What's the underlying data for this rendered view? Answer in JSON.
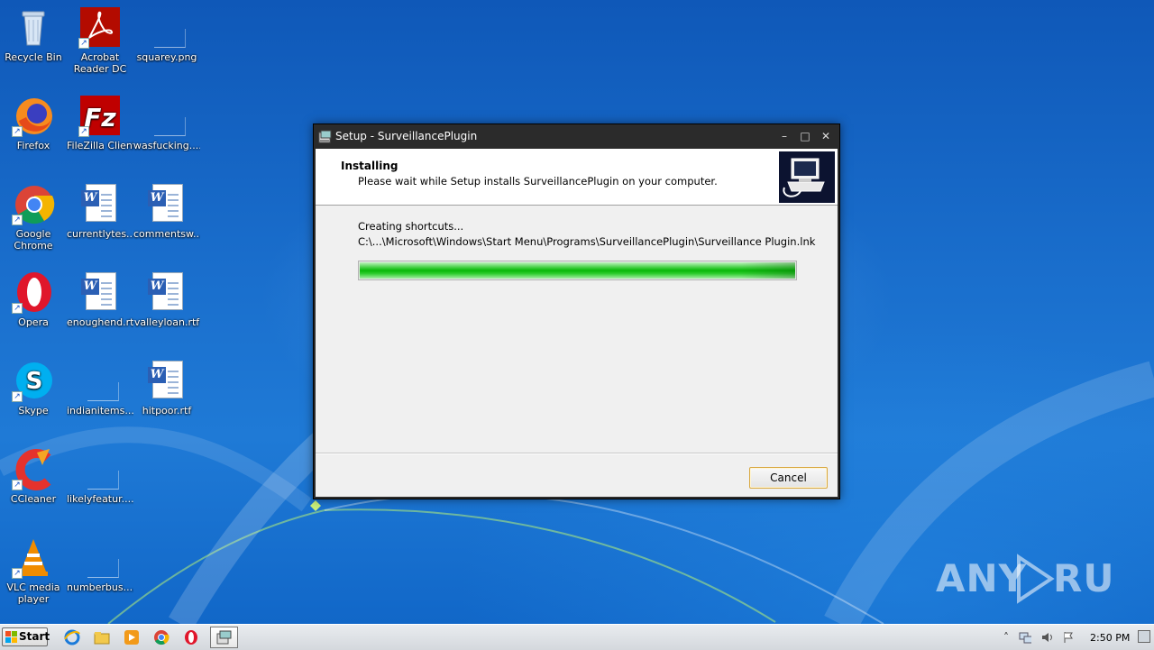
{
  "desktop": {
    "icons": [
      {
        "label": "Recycle Bin",
        "icon": "recycle-bin-icon"
      },
      {
        "label": "Acrobat Reader DC",
        "label_line1": "Acrobat",
        "label_line2": "Reader DC",
        "icon": "acrobat-icon"
      },
      {
        "label": "squarey.png",
        "icon": "image-file-icon"
      },
      {
        "label": "Firefox",
        "icon": "firefox-icon"
      },
      {
        "label": "FileZilla Client",
        "icon": "filezilla-icon"
      },
      {
        "label": "wasfucking....",
        "icon": "file-icon"
      },
      {
        "label": "Google Chrome",
        "label_line1": "Google",
        "label_line2": "Chrome",
        "icon": "chrome-icon"
      },
      {
        "label": "currentlytes....",
        "icon": "word-doc-icon"
      },
      {
        "label": "commentsw....",
        "icon": "word-doc-icon"
      },
      {
        "label": "Opera",
        "icon": "opera-icon"
      },
      {
        "label": "enoughend.rtf",
        "icon": "word-doc-icon"
      },
      {
        "label": "valleyloan.rtf",
        "icon": "word-doc-icon"
      },
      {
        "label": "Skype",
        "icon": "skype-icon"
      },
      {
        "label": "indianitems....",
        "icon": "file-icon"
      },
      {
        "label": "hitpoor.rtf",
        "icon": "word-doc-icon"
      },
      {
        "label": "CCleaner",
        "icon": "ccleaner-icon"
      },
      {
        "label": "likelyfeatur....",
        "icon": "file-icon"
      },
      {
        "label": "VLC media player",
        "label_line1": "VLC media",
        "label_line2": "player",
        "icon": "vlc-icon"
      },
      {
        "label": "numberbus....",
        "icon": "file-icon"
      }
    ]
  },
  "window": {
    "title": "Setup - SurveillancePlugin",
    "header_title": "Installing",
    "header_subtitle": "Please wait while Setup installs SurveillancePlugin on your computer.",
    "status_line1": "Creating shortcuts...",
    "status_line2": "C:\\...\\Microsoft\\Windows\\Start Menu\\Programs\\SurveillancePlugin\\Surveillance Plugin.lnk",
    "progress_fraction": 1.0,
    "cancel_label": "Cancel",
    "minimize_glyph": "–",
    "maximize_glyph": "□",
    "close_glyph": "✕"
  },
  "taskbar": {
    "start_label": "Start",
    "clock": "2:50 PM",
    "pinned": [
      "ie-icon",
      "explorer-icon",
      "media-player-icon",
      "chrome-icon",
      "opera-icon",
      "setup-icon"
    ]
  },
  "watermark": {
    "text": "ANY RUN"
  },
  "colors": {
    "desktop_blue": "#1c67c0",
    "progress_green": "#08b808",
    "cancel_border": "#d8a841"
  }
}
